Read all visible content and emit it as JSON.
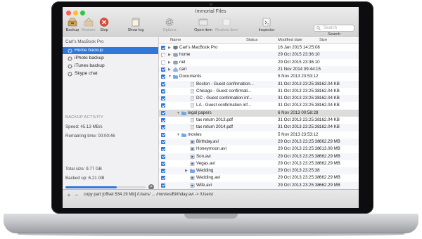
{
  "window": {
    "title": "Immortal Files"
  },
  "toolbar": {
    "backup": "Backup",
    "restore": "Restore",
    "stop": "Stop",
    "show_log": "Show log",
    "options": "Options",
    "open_item": "Open item",
    "restore_item": "Restore item",
    "inspector": "Inspector",
    "search_placeholder": "Search",
    "search_label": "Search"
  },
  "sidebar": {
    "header": "Carl's MacBook Pro",
    "items": [
      {
        "label": "Home backup",
        "icon": "gear-icon",
        "selected": true
      },
      {
        "label": "iPhoto backup",
        "icon": "gear-icon",
        "selected": false
      },
      {
        "label": "iTunes backup",
        "icon": "gear-icon",
        "selected": false
      },
      {
        "label": "Skype chat",
        "icon": "gear-icon",
        "selected": false
      }
    ]
  },
  "activity": {
    "header": "BACKUP ACTIVITY",
    "speed": "Speed: 45.13 MB/s",
    "remaining": "Remaining time: 00:00:46",
    "total": "Total size: 9.77 GB",
    "backed_up": "Backed up: 6.21 GB",
    "progress": 0.64
  },
  "list": {
    "columns": {
      "name": "Name",
      "status": "Status",
      "modified": "Modified date",
      "size": "Size"
    },
    "rows": [
      {
        "name": "Carl's MacBook Pro",
        "date": "16 Jan 2015 14:25:08",
        "size": "",
        "indent": 0,
        "disc": "right",
        "icon": "computer-icon",
        "checked": true
      },
      {
        "name": "home",
        "date": "29 Oct 2015 23:36:10",
        "size": "",
        "indent": 0,
        "disc": "right",
        "icon": "drive-icon",
        "checked": false
      },
      {
        "name": "net",
        "date": "29 Oct 2015 23:36:10",
        "size": "",
        "indent": 0,
        "disc": "right",
        "icon": "drive-icon",
        "checked": false
      },
      {
        "name": "carl",
        "date": "21 Nov 2014 09:44:15",
        "size": "",
        "indent": 0,
        "disc": "right",
        "icon": "home-icon",
        "checked": true
      },
      {
        "name": "Documents",
        "date": "5 Nov 2013 23:53:12",
        "size": "",
        "indent": 0,
        "disc": "down",
        "icon": "folder-icon",
        "checked": true
      },
      {
        "name": "Boston - Guest confirmation...",
        "date": "31 Oct 2013 23:25:38",
        "size": "162.04 KB",
        "indent": 2,
        "disc": "",
        "icon": "document-icon",
        "checked": true
      },
      {
        "name": "Chicago - Guest confirmati...",
        "date": "31 Oct 2013 23:25:38",
        "size": "162.04 KB",
        "indent": 2,
        "disc": "",
        "icon": "document-icon",
        "checked": true
      },
      {
        "name": "DC - Guest confirmation inf...",
        "date": "31 Oct 2013 23:25:38",
        "size": "162.04 KB",
        "indent": 2,
        "disc": "",
        "icon": "document-icon",
        "checked": true
      },
      {
        "name": "LA - Guest confirmation inf...",
        "date": "31 Oct 2013 23:25:38",
        "size": "162.04 KB",
        "indent": 2,
        "disc": "",
        "icon": "document-icon",
        "checked": true
      },
      {
        "name": "legal papers",
        "date": "6 Nov 2013 00:58:28",
        "size": "",
        "indent": 1,
        "disc": "down",
        "icon": "folder-icon",
        "checked": true,
        "selected": true
      },
      {
        "name": "tax return 2013.pdf",
        "date": "31 Oct 2013 23:25:38",
        "size": "162.04 KB",
        "indent": 2,
        "disc": "",
        "icon": "document-icon",
        "checked": true
      },
      {
        "name": "tax return 2014.pdf",
        "date": "31 Oct 2013 23:25:38",
        "size": "162.04 KB",
        "indent": 2,
        "disc": "",
        "icon": "document-icon",
        "checked": true
      },
      {
        "name": "movies",
        "date": "5 Nov 2013 23:53:12",
        "size": "",
        "indent": 1,
        "disc": "down",
        "icon": "folder-icon",
        "checked": true
      },
      {
        "name": "Birthday.avi",
        "date": "29 Oct 2013 23:25:38",
        "size": "662.29 MB",
        "indent": 2,
        "disc": "",
        "icon": "film-icon",
        "checked": true
      },
      {
        "name": "Honeymoon.avi",
        "date": "29 Oct 2013 23:25:38",
        "size": "613.08 MB",
        "indent": 2,
        "disc": "",
        "icon": "film-icon",
        "checked": true
      },
      {
        "name": "Son.avi",
        "date": "29 Oct 2013 23:25:38",
        "size": "662.29 MB",
        "indent": 2,
        "disc": "",
        "icon": "film-icon",
        "checked": true
      },
      {
        "name": "Vegas.avi",
        "date": "29 Oct 2013 23:25:38",
        "size": "662.29 MB",
        "indent": 2,
        "disc": "",
        "icon": "film-icon",
        "checked": true
      },
      {
        "name": "Wedding",
        "date": "29 Oct 2013 23:25:38",
        "size": "",
        "indent": 2,
        "disc": "right",
        "icon": "folder-icon",
        "checked": true
      },
      {
        "name": "Wedding.avi",
        "date": "29 Oct 2013 23:25:38",
        "size": "662.29 MB",
        "indent": 2,
        "disc": "",
        "icon": "film-icon",
        "checked": true
      },
      {
        "name": "Wife.avi",
        "date": "29 Oct 2013 23:25:38",
        "size": "662.29 MB",
        "indent": 2,
        "disc": "",
        "icon": "film-icon",
        "checked": true
      },
      {
        "name": "music",
        "date": "5 Nov 2013 23:53:12",
        "size": "",
        "indent": 1,
        "disc": "right",
        "icon": "folder-icon",
        "checked": true
      }
    ]
  },
  "statusbar": {
    "add": "+",
    "remove": "−",
    "text": "copy part [offset 534.19 Mb] /Users/ ... /movies/Birthday.avi -> /Users/"
  },
  "colors": {
    "accent": "#2f77d8",
    "stop": "#e04a3a"
  }
}
